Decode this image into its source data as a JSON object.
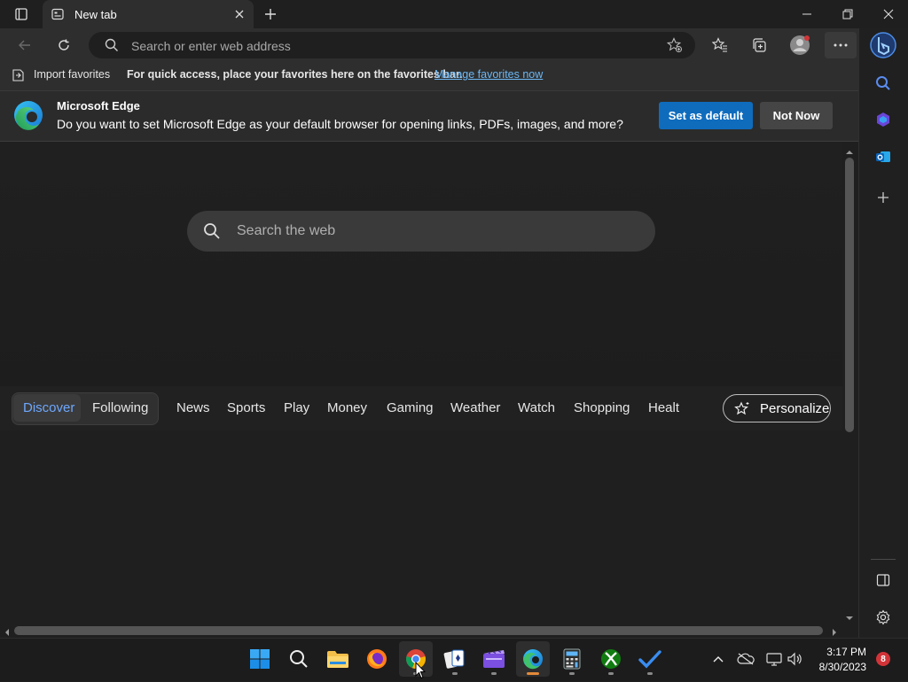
{
  "titlebar": {
    "tab_title": "New tab",
    "window_controls": [
      "minimize",
      "restore",
      "close"
    ]
  },
  "navigation": {
    "address_placeholder": "Search or enter web address"
  },
  "favorites_bar": {
    "import_label": "Import favorites",
    "hint": "For quick access, place your favorites here on the favorites bar.",
    "manage_link": "Manage favorites now"
  },
  "infobar": {
    "title": "Microsoft Edge",
    "message": "Do you want to set Microsoft Edge as your default browser for opening links, PDFs, images, and more?",
    "primary_button": "Set as default",
    "secondary_button": "Not Now"
  },
  "page": {
    "search_placeholder": "Search the web",
    "feed_tabs": {
      "discover": "Discover",
      "following": "Following",
      "items": [
        "News",
        "Sports",
        "Play",
        "Money",
        "Gaming",
        "Weather",
        "Watch",
        "Shopping",
        "Health"
      ]
    },
    "personalize_label": "Personalize"
  },
  "taskbar": {
    "time": "3:17 PM",
    "date": "8/30/2023",
    "notification_count": "8"
  },
  "colors": {
    "accent": "#0f6cbd",
    "link": "#6cb8f6",
    "discover": "#6da8ff",
    "badge": "#d13438"
  }
}
